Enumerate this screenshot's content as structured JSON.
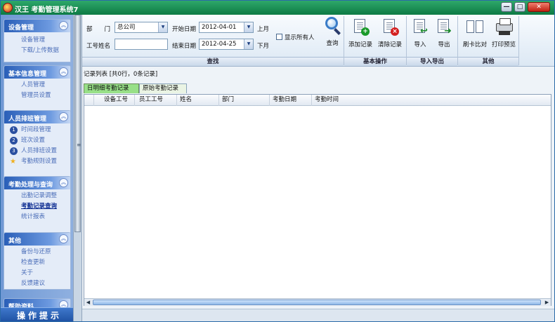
{
  "window": {
    "title": "汉王 考勤管理系统7",
    "min_label": "—",
    "max_label": "□",
    "close_label": "✕"
  },
  "sidebar": {
    "groups": [
      {
        "title": "设备管理",
        "items": [
          "设备管理",
          "下载/上传数据"
        ]
      },
      {
        "title": "基本信息管理",
        "items": [
          "人员管理",
          "管理员设置"
        ]
      },
      {
        "title": "人员排班管理",
        "items": [
          "时间段管理",
          "班次设置",
          "人员排班设置",
          "考勤规则设置"
        ]
      },
      {
        "title": "考勤处理与查询",
        "items": [
          "出勤记录调整",
          "考勤记录查询",
          "统计报表"
        ]
      },
      {
        "title": "其他",
        "items": [
          "备份与还原",
          "检查更新",
          "关于",
          "反馈建议"
        ]
      },
      {
        "title": "帮助资料"
      }
    ],
    "collapse_glyph": "︽",
    "step_numbers": [
      "1",
      "2",
      "3"
    ],
    "tips_button": "操作提示"
  },
  "filter": {
    "dept_label": "部　　门",
    "dept_value": "总公司",
    "emp_label": "工号姓名",
    "emp_value": "",
    "start_label": "开始日期",
    "start_value": "2012-04-01",
    "end_label": "结束日期",
    "end_value": "2012-04-25",
    "prev_month": "上月",
    "next_month": "下月",
    "show_all_label": "显示所有人",
    "query_label": "查询",
    "section_label": "查找"
  },
  "toolbar": {
    "add_label": "添加记录",
    "clear_label": "清除记录",
    "basic_section": "基本操作",
    "import_label": "导入",
    "export_label": "导出",
    "io_section": "导入导出",
    "compare_label": "刷卡比对",
    "print_label": "打印预览",
    "other_section": "其他"
  },
  "records": {
    "summary": "记录列表 [共0行，0条记录]",
    "tabs": [
      "日明细考勤记录",
      "原始考勤记录"
    ],
    "columns": [
      "设备工号",
      "员工工号",
      "姓名",
      "部门",
      "考勤日期",
      "考勤时间"
    ]
  },
  "colors": {
    "title_bar": "#0d7a44",
    "sidebar_head": "#2a5fb8",
    "active_tab": "#98e088"
  }
}
